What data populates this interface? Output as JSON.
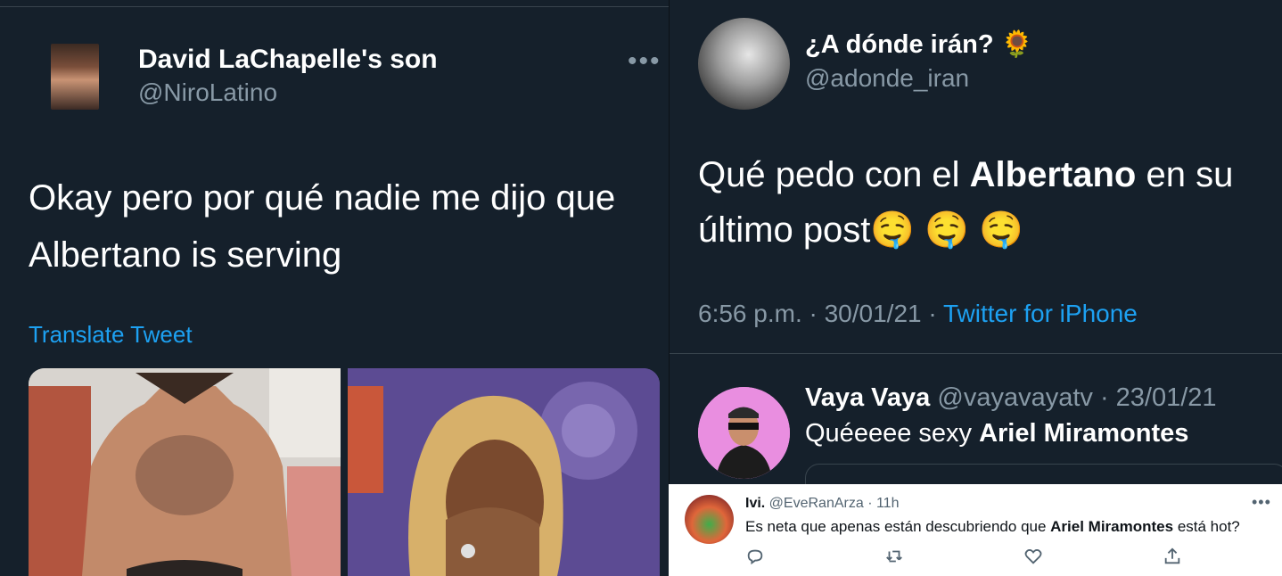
{
  "left_tweet": {
    "author_name": "David LaChapelle's son",
    "author_handle": "@NiroLatino",
    "more_label": "•••",
    "body_line1": "Okay pero por qué nadie me dijo que",
    "body_line2": "Albertano is serving",
    "translate_label": "Translate Tweet"
  },
  "right_tweet": {
    "author_name": "¿A dónde irán? 🌻",
    "author_handle": "@adonde_iran",
    "body_pre": "Qué pedo con el ",
    "body_bold": "Albertano",
    "body_post": " en su",
    "body_line2": "último post🤤 🤤 🤤",
    "time": "6:56 p.m. · 30/01/21 · ",
    "source": "Twitter for iPhone"
  },
  "reply_tweet": {
    "author_name": "Vaya Vaya",
    "author_handle_date": " @vayavayatv · 23/01/21",
    "text_pre": "Quéeeee sexy ",
    "text_bold": "Ariel Miramontes"
  },
  "overlay_tweet": {
    "author_name": "Ivi.",
    "author_handle_time": " @EveRanArza · 11h",
    "more_label": "•••",
    "text_pre": "Es neta que apenas están descubriendo que ",
    "text_bold": "Ariel Miramontes",
    "text_post": " está hot?",
    "actions": [
      "reply-icon",
      "retweet-icon",
      "like-icon",
      "share-icon"
    ]
  },
  "colors": {
    "background_dark": "#15202b",
    "link_blue": "#1da1f2",
    "secondary_text": "#8899a6"
  }
}
